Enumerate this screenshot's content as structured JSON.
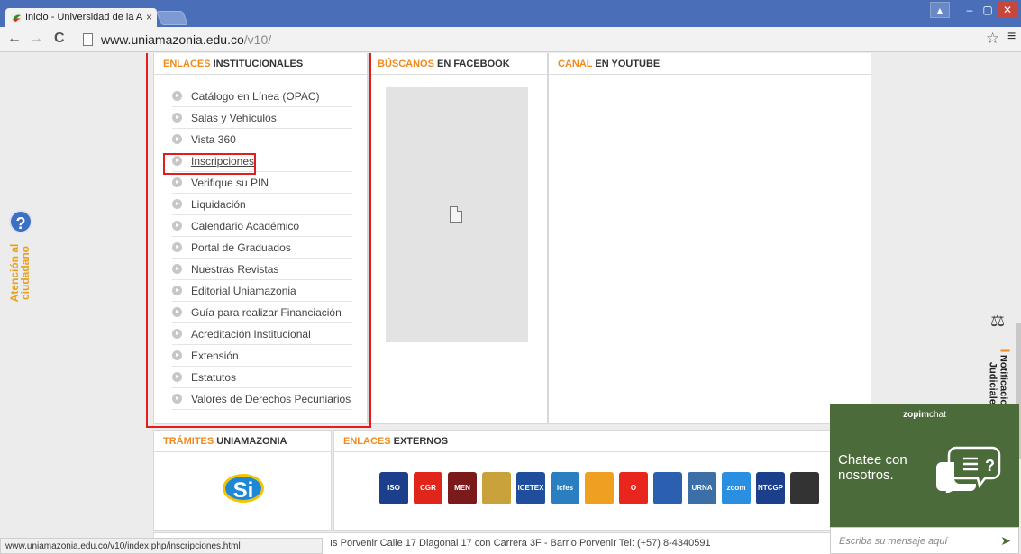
{
  "browser": {
    "tab_title": "Inicio - Universidad de la A",
    "tab_close": "×",
    "url_host": "www.uniamazonia.edu.co",
    "url_path": "/v10/",
    "window_user": "▲",
    "window_min": "–",
    "window_max": "▢",
    "window_close": "✕",
    "back": "←",
    "forward": "→",
    "reload": "C",
    "star": "☆",
    "menu": "≡",
    "status_url": "www.uniamazonia.edu.co/v10/index.php/inscripciones.html"
  },
  "sections": {
    "enlaces_inst": {
      "accent": "ENLACES",
      "rest": " INSTITUCIONALES"
    },
    "facebook": {
      "accent": "BÚSCANOS",
      "rest": " EN FACEBOOK"
    },
    "youtube": {
      "accent": "CANAL",
      "rest": " EN YOUTUBE"
    },
    "tramites": {
      "accent": "TRÁMITES",
      "rest": " UNIAMAZONIA"
    },
    "enlaces_ext": {
      "accent": "ENLACES",
      "rest": " EXTERNOS"
    }
  },
  "institutional_links": [
    "Catálogo en Línea (OPAC)",
    "Salas y Vehículos",
    "Vista 360",
    "Inscripciones",
    "Verifique su PIN",
    "Liquidación",
    "Calendario Académico",
    "Portal de Graduados",
    "Nuestras Revistas",
    "Editorial Uniamazonia",
    "Guía para realizar Financiación",
    "Acreditación Institucional",
    "Extensión",
    "Estatutos",
    "Valores de Derechos Pecuniarios"
  ],
  "tramites_logo": "Si",
  "external_logos": [
    {
      "label": "ISO",
      "color": "#1b3f8a"
    },
    {
      "label": "CGR",
      "color": "#e0261b"
    },
    {
      "label": "MEN",
      "color": "#7a1a1a"
    },
    {
      "label": "",
      "color": "#c9a23b"
    },
    {
      "label": "ICETEX",
      "color": "#1f4e9c"
    },
    {
      "label": "icfes",
      "color": "#2a7fc1"
    },
    {
      "label": "",
      "color": "#f0a020"
    },
    {
      "label": "O",
      "color": "#e8261e"
    },
    {
      "label": "",
      "color": "#2b5fb0"
    },
    {
      "label": "URNA",
      "color": "#3a6fa8"
    },
    {
      "label": "zoom",
      "color": "#2a8fe0"
    },
    {
      "label": "NTCGP",
      "color": "#1b3f8a"
    },
    {
      "label": "",
      "color": "#333333"
    }
  ],
  "footer": "ıs Porvenir Calle 17 Diagonal 17 con Carrera 3F - Barrio Porvenir  Tel: (+57) 8-4340591",
  "side": {
    "help": "?",
    "atencion_line1": "Atención al",
    "atencion_line2": "ciudadano",
    "notif_line1": "Notificaciones",
    "notif_line2": "Judiciales",
    "scale": "⚖"
  },
  "chat": {
    "brand_bold": "zopim",
    "brand_rest": "chat",
    "line1": "Chatee con",
    "line2": "nosotros.",
    "placeholder": "Escriba su mensaje aquí",
    "send": "➤"
  }
}
